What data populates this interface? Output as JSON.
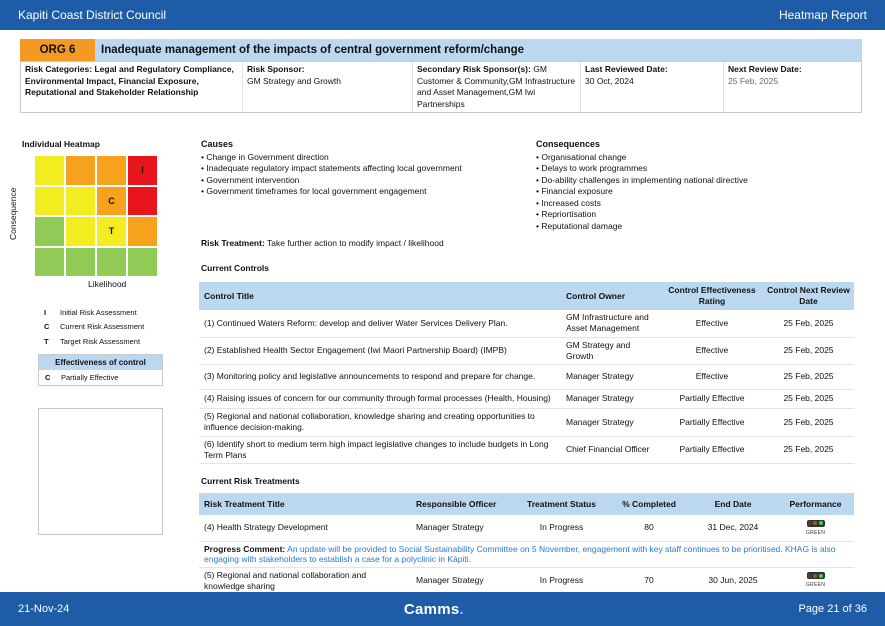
{
  "header": {
    "council": "Kapiti Coast District Council",
    "report": "Heatmap Report"
  },
  "risk": {
    "code": "ORG 6",
    "title": "Inadequate management of the impacts of central government reform/change",
    "categories_label": "Risk Categories:",
    "categories_value": "Legal and Regulatory Compliance, Environmental Impact, Financial Exposure, Reputational and Stakeholder Relationship",
    "sponsor_label": "Risk Sponsor:",
    "sponsor_value": "GM Strategy and Growth",
    "secondary_label": "Secondary Risk Sponsor(s):",
    "secondary_value": "GM Customer & Community,GM Infrastructure and Asset Management,GM Iwi Partnerships",
    "last_reviewed_label": "Last Reviewed Date:",
    "last_reviewed_value": "30 Oct, 2024",
    "next_review_label": "Next Review Date:",
    "next_review_value": "25 Feb, 2025"
  },
  "heatmap": {
    "title": "Individual Heatmap",
    "x_label": "Likelihood",
    "y_label": "Consequence",
    "colors": {
      "red": "#e8161c",
      "orange": "#f6a21d",
      "yellow": "#f2ec20",
      "green": "#8fcb55"
    },
    "grid": [
      [
        "yellow",
        "orange",
        "orange",
        "red"
      ],
      [
        "yellow",
        "yellow",
        "orange",
        "red"
      ],
      [
        "green",
        "yellow",
        "yellow",
        "orange"
      ],
      [
        "green",
        "green",
        "green",
        "green"
      ]
    ],
    "markers": [
      {
        "label": "I",
        "row": 0,
        "col": 3
      },
      {
        "label": "C",
        "row": 1,
        "col": 2
      },
      {
        "label": "T",
        "row": 2,
        "col": 2
      }
    ],
    "legend": [
      {
        "key": "I",
        "text": "Initial Risk Assessment"
      },
      {
        "key": "C",
        "text": "Current Risk Assessment"
      },
      {
        "key": "T",
        "text": "Target Risk Assessment"
      }
    ],
    "effectiveness_title": "Effectiveness of control",
    "effectiveness": {
      "key": "C",
      "text": "Partially Effective"
    }
  },
  "causes": {
    "title": "Causes",
    "items": [
      "• Change in Government direction",
      "• Inadequate regulatory impact statements affecting local government",
      "• Government intervention",
      "• Government timeframes for local government engagement"
    ]
  },
  "consequences": {
    "title": "Consequences",
    "items": [
      "• Organisational change",
      "• Delays to work programmes",
      "• Do-ability challenges in implementing national directive",
      "• Financial exposure",
      "• Increased costs",
      "• Repriortisation",
      "• Reputational damage"
    ]
  },
  "treatment": {
    "label": "Risk Treatment:",
    "value": "Take further action to modify impact / likelihood"
  },
  "controls": {
    "title": "Current Controls",
    "headers": [
      "Control Title",
      "Control Owner",
      "Control Effectiveness Rating",
      "Control Next Review Date"
    ],
    "rows": [
      [
        "(1) Continued Waters Reform: develop and deliver Water Services Delivery Plan.",
        "GM Infrastructure and Asset Management",
        "Effective",
        "25 Feb, 2025"
      ],
      [
        "(2) Established Health Sector Engagement (Iwi Maori Partnership Board) (IMPB)",
        "GM Strategy and Growth",
        "Effective",
        "25 Feb, 2025"
      ],
      [
        "(3) Monitoring policy and legislative announcements to respond and prepare for change.",
        "Manager Strategy",
        "Effective",
        "25 Feb, 2025"
      ],
      [
        "(4) Raising issues of concern for our community through formal processes (Health, Housing)",
        "Manager Strategy",
        "Partially Effective",
        "25 Feb, 2025"
      ],
      [
        "(5) Regional and national collaboration, knowledge sharing and creating opportunities to influence decision-making.",
        "Manager Strategy",
        "Partially Effective",
        "25 Feb, 2025"
      ],
      [
        "(6) Identify short to medium term high impact legislative changes to include budgets in Long Term Plans",
        "Chief Financial Officer",
        "Partially Effective",
        "25 Feb, 2025"
      ]
    ]
  },
  "treatments": {
    "title": "Current Risk Treatments",
    "headers": [
      "Risk Treatment Title",
      "Responsible Officer",
      "Treatment Status",
      "% Completed",
      "End Date",
      "Performance"
    ],
    "rows": [
      {
        "title": "(4) Health Strategy Development",
        "officer": "Manager Strategy",
        "status": "In Progress",
        "completed": "80",
        "end": "31 Dec, 2024",
        "performance": "GREEN",
        "icon": "traffic-light-icon"
      },
      {
        "title": "(5) Regional and national collaboration and knowledge sharing",
        "officer": "Manager Strategy",
        "status": "In Progress",
        "completed": "70",
        "end": "30 Jun, 2025",
        "performance": "GREEN",
        "icon": "traffic-light-icon"
      }
    ],
    "progress_label": "Progress Comment:",
    "progress_text": "An update will be provided to Social Sustainability Committee on 5 November, engagement with key staff continues to be prioritised. KHAG is also engaging with stakeholders to establish a case for a polyclinic in Kāpiti."
  },
  "footer": {
    "date": "21-Nov-24",
    "logo": "Camms",
    "page": "Page 21 of 36"
  }
}
